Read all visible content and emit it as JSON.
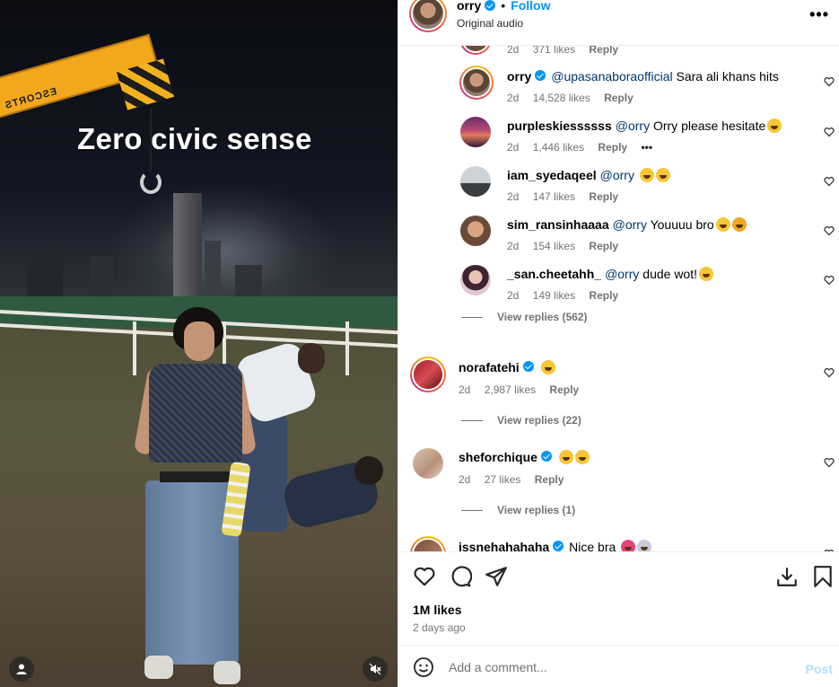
{
  "media": {
    "overlay_text": "Zero civic sense",
    "crane_text": "ESCORTS",
    "user_icon": "user-icon",
    "mute_icon": "mute-icon"
  },
  "header": {
    "username": "orry",
    "follow_label": "Follow",
    "separator": "•",
    "subtitle": "Original audio",
    "more_label": "•••"
  },
  "comments": [
    {
      "meta_likes": "371 likes",
      "meta_time": "2d",
      "reply": "Reply"
    },
    {
      "username": "orry",
      "verified": true,
      "mention": "@upasanaboraofficial",
      "text": "Sara ali khans hits",
      "time": "2d",
      "likes": "14,528 likes",
      "reply": "Reply"
    },
    {
      "username": "purpleskiessssss",
      "mention": "@orry",
      "text": "Orry please hesitate",
      "time": "2d",
      "likes": "1,446 likes",
      "reply": "Reply",
      "more": "•••"
    },
    {
      "username": "iam_syedaqeel",
      "mention": "@orry",
      "text": "",
      "time": "2d",
      "likes": "147 likes",
      "reply": "Reply"
    },
    {
      "username": "sim_ransinhaaaa",
      "mention": "@orry",
      "text": "Youuuu bro",
      "time": "2d",
      "likes": "154 likes",
      "reply": "Reply"
    },
    {
      "username": "_san.cheetahh_",
      "mention": "@orry",
      "text": "dude wot!",
      "time": "2d",
      "likes": "149 likes",
      "reply": "Reply"
    },
    {
      "view_replies": "View replies (562)"
    },
    {
      "username": "norafatehi",
      "verified": true,
      "text": "",
      "time": "2d",
      "likes": "2,987 likes",
      "reply": "Reply"
    },
    {
      "view_replies": "View replies (22)"
    },
    {
      "username": "sheforchique",
      "verified": true,
      "text": "",
      "time": "2d",
      "likes": "27 likes",
      "reply": "Reply"
    },
    {
      "view_replies": "View replies (1)"
    },
    {
      "username": "issnehahahaha",
      "verified": true,
      "text": "Nice bra"
    }
  ],
  "actions": {
    "like_icon": "heart-icon",
    "comment_icon": "comment-icon",
    "share_icon": "share-icon",
    "download_icon": "download-icon",
    "save_icon": "bookmark-icon",
    "likes_count": "1M likes",
    "posted": "2 days ago"
  },
  "composer": {
    "placeholder": "Add a comment...",
    "post_label": "Post",
    "emoji_icon": "emoji-icon"
  },
  "colors": {
    "accent": "#0095f6",
    "mention": "#00376b",
    "muted": "#737373",
    "post_disabled": "#b2dffc"
  }
}
